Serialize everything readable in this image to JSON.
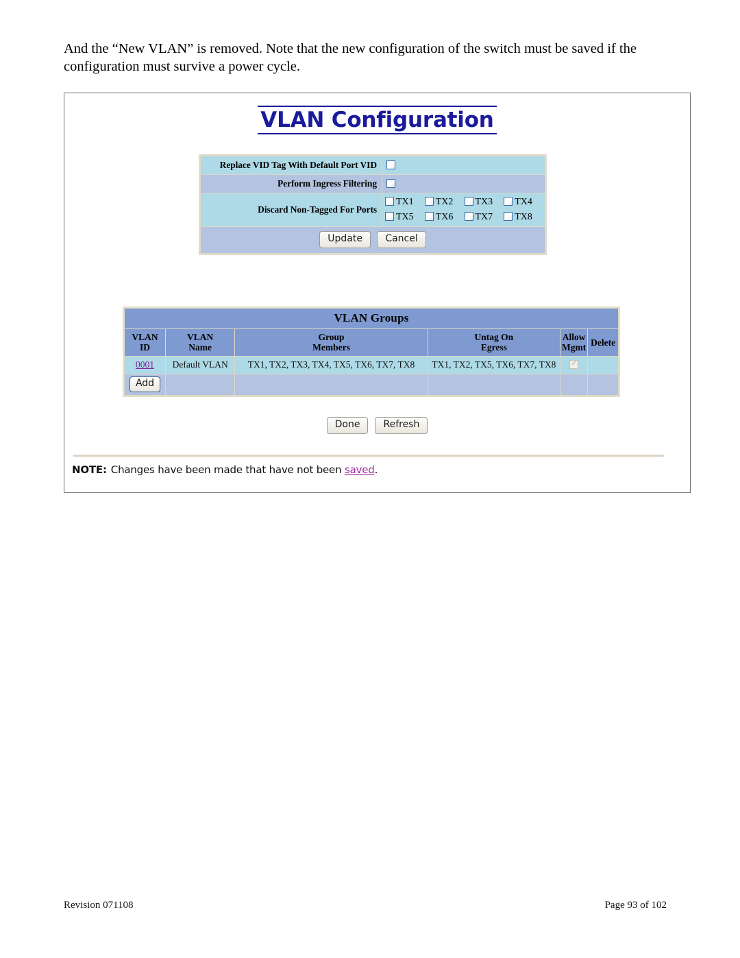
{
  "document": {
    "intro_paragraph": "And the “New VLAN” is removed. Note that the new configuration of the switch must be saved if the configuration must survive a power cycle.",
    "footer_left": "Revision 071108",
    "footer_right": "Page 93 of 102"
  },
  "screen": {
    "title": "VLAN Configuration",
    "title_color": "#1b1b9c",
    "settings": {
      "rows": [
        {
          "label": "Replace VID Tag With Default Port VID",
          "checked": false,
          "bg": "#aed9e6"
        },
        {
          "label": "Perform Ingress Filtering",
          "checked": false,
          "bg": "#b3c3e0"
        }
      ],
      "discard_label": "Discard Non-Tagged For Ports",
      "ports": [
        {
          "label": "TX1",
          "checked": false
        },
        {
          "label": "TX2",
          "checked": false
        },
        {
          "label": "TX3",
          "checked": false
        },
        {
          "label": "TX4",
          "checked": false
        },
        {
          "label": "TX5",
          "checked": false
        },
        {
          "label": "TX6",
          "checked": false
        },
        {
          "label": "TX7",
          "checked": false
        },
        {
          "label": "TX8",
          "checked": false
        }
      ],
      "update_label": "Update",
      "cancel_label": "Cancel"
    },
    "groups": {
      "caption": "VLAN Groups",
      "headers": {
        "vlan_id": "VLAN\nID",
        "vlan_id_l1": "VLAN",
        "vlan_id_l2": "ID",
        "vlan_name_l1": "VLAN",
        "vlan_name_l2": "Name",
        "group_members_l1": "Group",
        "group_members_l2": "Members",
        "untag_egress_l1": "Untag On",
        "untag_egress_l2": "Egress",
        "allow_mgmt_l1": "Allow",
        "allow_mgmt_l2": "Mgmt",
        "delete": "Delete"
      },
      "rows": [
        {
          "vlan_id": "0001",
          "vlan_name": "Default VLAN",
          "group_members": "TX1, TX2, TX3, TX4, TX5, TX6, TX7, TX8",
          "untag_on_egress": "TX1, TX2, TX5, TX6, TX7, TX8",
          "allow_mgmt_checked": true,
          "allow_mgmt_disabled": true,
          "delete": ""
        }
      ],
      "add_label": "Add"
    },
    "actions": {
      "done_label": "Done",
      "refresh_label": "Refresh"
    },
    "note": {
      "label": "NOTE:",
      "text_before": "Changes have been made that have not been ",
      "link_text": "saved",
      "text_after": "."
    }
  },
  "colors": {
    "row_cyan": "#aed9e6",
    "row_blue": "#b3c3e0",
    "table_header_blue": "#7f9ad1",
    "table_border_tan": "#ded8c8",
    "link_purple": "#7b1fa2",
    "note_link_purple": "#9c27a0",
    "title_navy": "#1b1b9c"
  }
}
